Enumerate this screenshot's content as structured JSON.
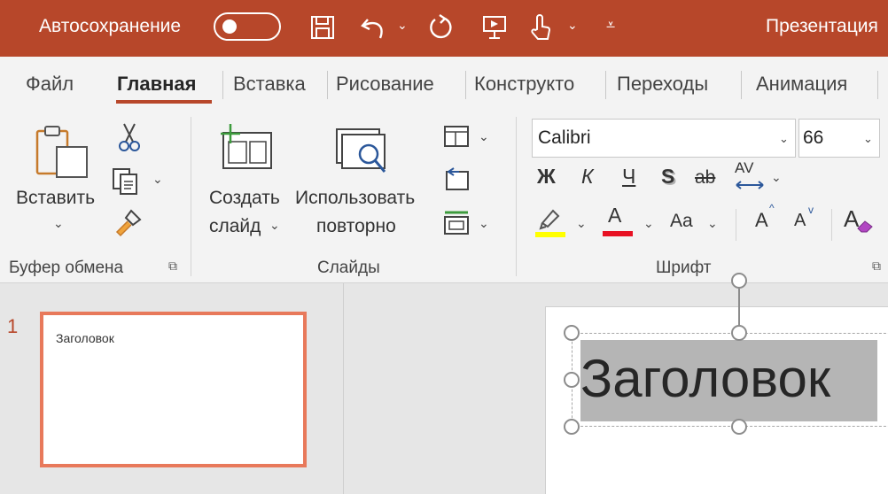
{
  "titlebar": {
    "autosave_label": "Автосохранение",
    "document_title": "Презентация",
    "background_color": "#b7472a"
  },
  "tabs": [
    {
      "label": "Файл",
      "active": false
    },
    {
      "label": "Главная",
      "active": true
    },
    {
      "label": "Вставка",
      "active": false
    },
    {
      "label": "Рисование",
      "active": false
    },
    {
      "label": "Конструкто",
      "active": false
    },
    {
      "label": "Переходы",
      "active": false
    },
    {
      "label": "Анимация",
      "active": false
    }
  ],
  "ribbon": {
    "clipboard": {
      "group_label": "Буфер обмена",
      "paste_label": "Вставить"
    },
    "slides": {
      "group_label": "Слайды",
      "new_slide_line1": "Создать",
      "new_slide_line2": "слайд",
      "reuse_line1": "Использовать",
      "reuse_line2": "повторно"
    },
    "font": {
      "group_label": "Шрифт",
      "font_name": "Calibri",
      "font_size": "66",
      "bold": "Ж",
      "italic": "К",
      "underline": "Ч",
      "shadow": "S",
      "strike": "ab",
      "spacing": "AV",
      "change_case": "Aa",
      "grow": "A",
      "shrink": "A",
      "clear": "A",
      "font_color": "A",
      "highlight_color": "#ffff00",
      "font_color_value": "#e81123"
    }
  },
  "slides_panel": {
    "slide_number": "1",
    "thumbnail_title": "Заголовок",
    "accent": "#e8795b"
  },
  "editor": {
    "title_text": "Заголовок"
  }
}
